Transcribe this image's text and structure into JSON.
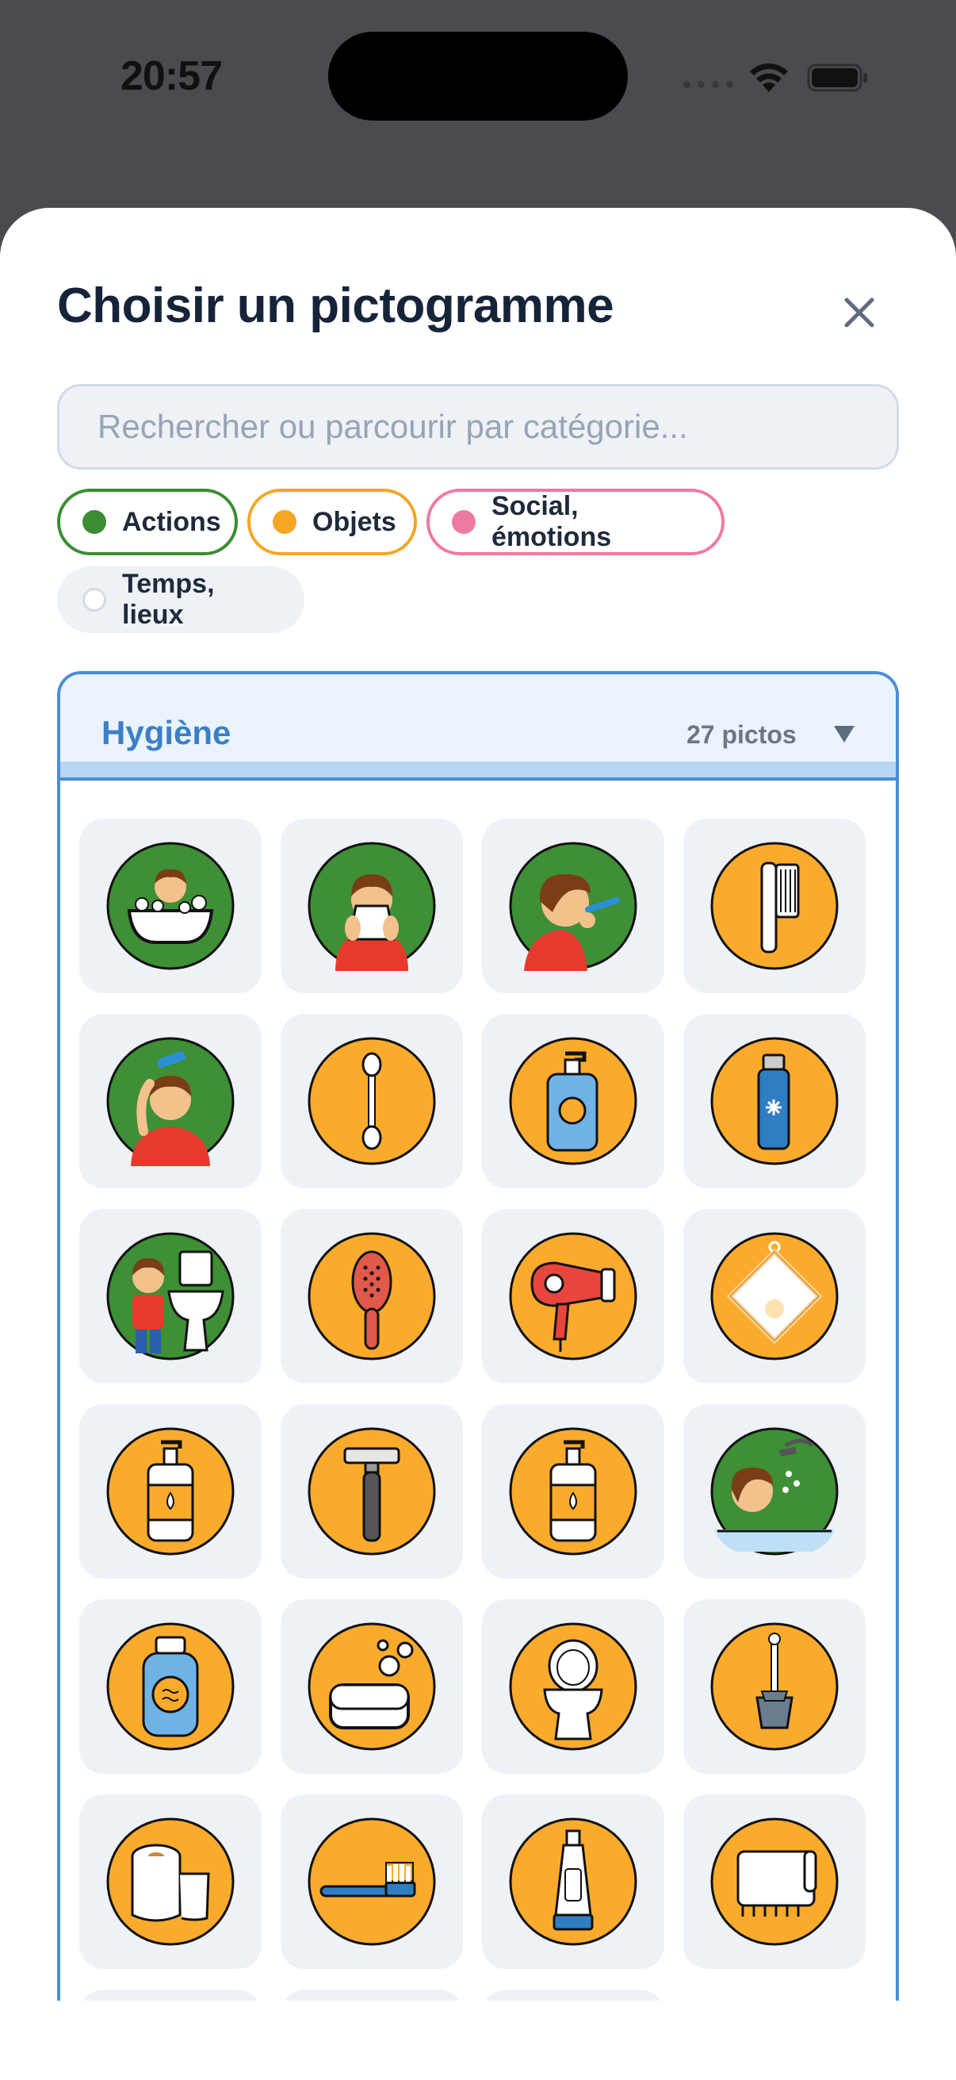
{
  "status_bar": {
    "time": "20:57"
  },
  "sheet": {
    "title": "Choisir un pictogramme",
    "search_placeholder": "Rechercher ou parcourir par catégorie..."
  },
  "filters": [
    {
      "label": "Actions",
      "color": "#3b8c32"
    },
    {
      "label": "Objets",
      "color": "#f5a623"
    },
    {
      "label": "Social, émotions",
      "color": "#ef7aa0"
    },
    {
      "label": "Temps, lieux",
      "color": "#ffffff"
    }
  ],
  "category": {
    "title": "Hygiène",
    "count": "27 pictos",
    "accent": "#4a8ed6"
  },
  "pictograms": [
    {
      "icon": "child-bathing-icon",
      "kind": "action"
    },
    {
      "icon": "blowing-nose-icon",
      "kind": "action"
    },
    {
      "icon": "brushing-teeth-icon",
      "kind": "action"
    },
    {
      "icon": "comb-icon",
      "kind": "object"
    },
    {
      "icon": "combing-hair-icon",
      "kind": "action"
    },
    {
      "icon": "cotton-swab-icon",
      "kind": "object"
    },
    {
      "icon": "pump-soap-icon",
      "kind": "object"
    },
    {
      "icon": "deodorant-spray-icon",
      "kind": "object"
    },
    {
      "icon": "using-toilet-icon",
      "kind": "action"
    },
    {
      "icon": "hairbrush-icon",
      "kind": "object"
    },
    {
      "icon": "hair-dryer-icon",
      "kind": "object"
    },
    {
      "icon": "washcloth-icon",
      "kind": "object"
    },
    {
      "icon": "liquid-soap-icon",
      "kind": "object"
    },
    {
      "icon": "razor-icon",
      "kind": "object"
    },
    {
      "icon": "hand-soap-icon",
      "kind": "object"
    },
    {
      "icon": "showering-icon",
      "kind": "action"
    },
    {
      "icon": "shampoo-icon",
      "kind": "object"
    },
    {
      "icon": "soap-bar-icon",
      "kind": "object"
    },
    {
      "icon": "toilet-icon",
      "kind": "object"
    },
    {
      "icon": "toilet-brush-icon",
      "kind": "object"
    },
    {
      "icon": "toilet-paper-icon",
      "kind": "object"
    },
    {
      "icon": "toothbrush-icon",
      "kind": "object"
    },
    {
      "icon": "toothpaste-icon",
      "kind": "object"
    },
    {
      "icon": "towel-icon",
      "kind": "object"
    }
  ],
  "colors": {
    "action_bg": "#3e8f35",
    "object_bg": "#fbab2c"
  }
}
